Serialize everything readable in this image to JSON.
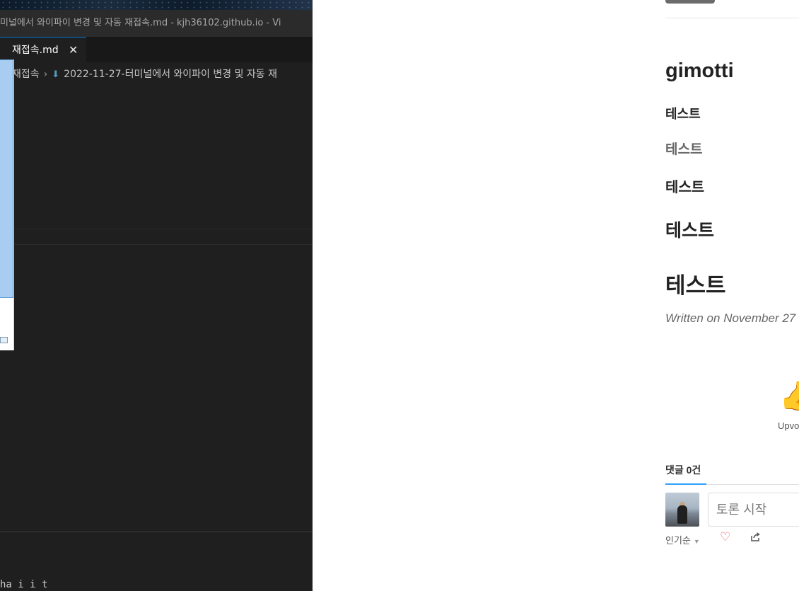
{
  "vscode": {
    "window_title": "미널에서 와이파이 변경 및 자동 재접속.md - kjh36102.github.io - Vi",
    "active_tab": {
      "label": "재접속.md",
      "close_icon": "close-icon"
    },
    "breadcrumb": {
      "folder": "재접속",
      "separator_icon": "chevron-right-icon",
      "file_icon": "markdown-arrow-icon",
      "file": "2022-11-27-터미널에서 와이파이 변경 및 자동 재"
    },
    "panel_text": "ha i i t"
  },
  "blog": {
    "post_title": "gimotti",
    "headings": [
      "테스트",
      "테스트",
      "테스트",
      "테스트",
      "테스트"
    ],
    "date": "Written on November 27",
    "reaction": {
      "icon": "thumbs-up-icon",
      "label": "Upvo"
    },
    "comments": {
      "tab_label": "댓글 0건",
      "input_placeholder": "토론 시작",
      "sort_label": "인기순",
      "heart_icon": "heart-icon",
      "share_icon": "share-icon"
    },
    "colors": {
      "accent": "#2e9fff",
      "heart": "#e4606d",
      "vscode_bg": "#1f1f1f"
    }
  }
}
